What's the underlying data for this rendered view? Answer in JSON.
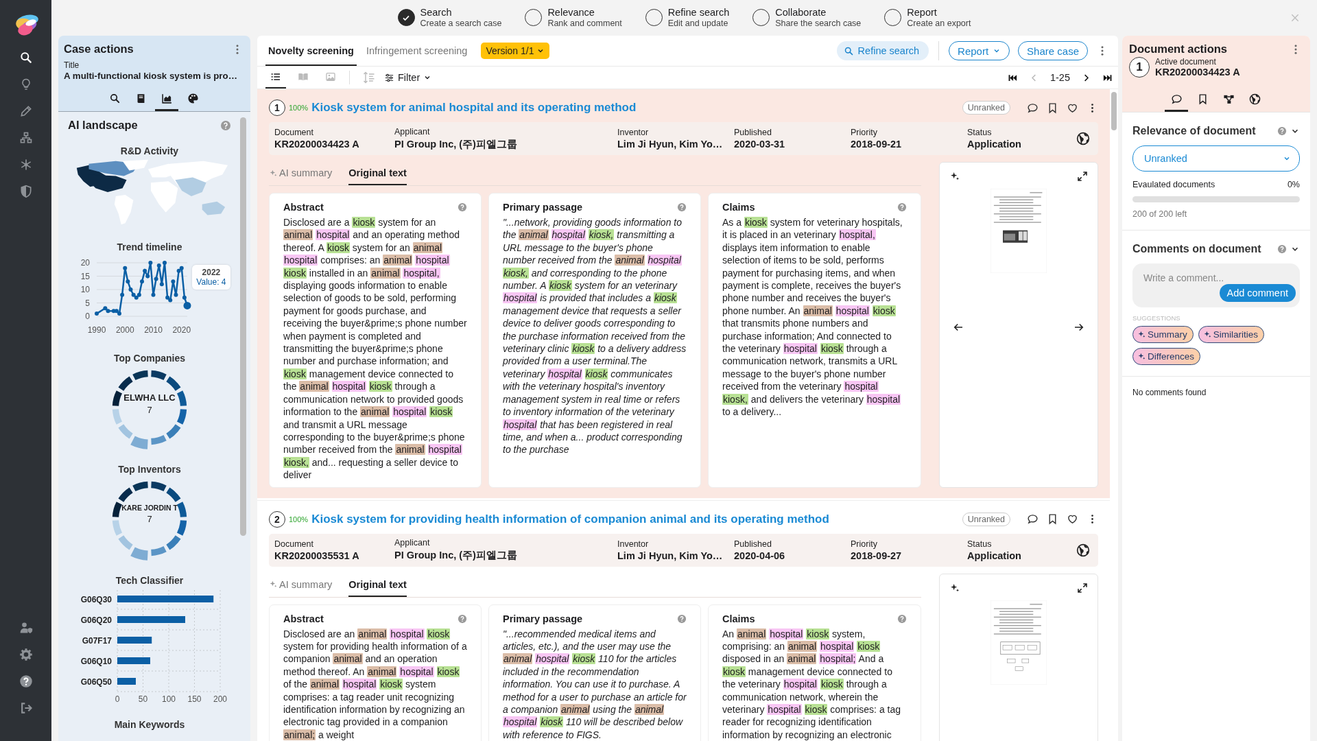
{
  "nav": {
    "items": [
      {
        "kind": "search",
        "selected": true
      },
      {
        "kind": "bulb",
        "selected": false
      },
      {
        "kind": "pencil",
        "selected": false
      },
      {
        "kind": "sitemap",
        "selected": false
      },
      {
        "kind": "hub",
        "selected": false
      },
      {
        "kind": "shield",
        "selected": false
      }
    ],
    "bottom_items": [
      {
        "kind": "user-shield",
        "selected": false
      },
      {
        "kind": "gear",
        "selected": false
      },
      {
        "kind": "help",
        "selected": false
      },
      {
        "kind": "logout",
        "selected": false
      }
    ]
  },
  "steps": [
    {
      "title": "Search",
      "subtitle": "Create a search case",
      "done": true
    },
    {
      "title": "Relevance",
      "subtitle": "Rank and comment",
      "done": false
    },
    {
      "title": "Refine search",
      "subtitle": "Edit and update",
      "done": false
    },
    {
      "title": "Collaborate",
      "subtitle": "Share the search case",
      "done": false
    },
    {
      "title": "Report",
      "subtitle": "Create an export",
      "done": false
    }
  ],
  "case_panel": {
    "heading": "Case actions",
    "title_label": "Title",
    "title": "A multi-functional kiosk system is pro…",
    "tabs": [
      {
        "kind": "search",
        "selected": false
      },
      {
        "kind": "book",
        "selected": false
      },
      {
        "kind": "chart",
        "selected": true
      },
      {
        "kind": "palette",
        "selected": false
      }
    ],
    "landscape": {
      "heading": "AI landscape",
      "map_title": "R&D Activity",
      "trend": {
        "chart_data": {
          "type": "line",
          "title": "Trend timeline",
          "x": [
            1990,
            1993,
            1994,
            1996,
            1997,
            1998,
            1999,
            2000,
            2001,
            2002,
            2003,
            2004,
            2005,
            2006,
            2007,
            2008,
            2009,
            2010,
            2011,
            2012,
            2013,
            2014,
            2015,
            2016,
            2017,
            2018,
            2019,
            2020,
            2021,
            2022
          ],
          "series": [
            {
              "color": "#0b5fa5",
              "values": [
                1,
                3,
                2,
                2,
                2,
                1,
                8,
                18,
                13,
                10,
                8,
                7,
                8,
                13,
                17,
                15,
                20,
                8,
                14,
                19,
                12,
                20,
                7,
                6,
                13,
                8,
                17,
                18,
                7,
                4
              ]
            }
          ],
          "xlim": [
            1990,
            2022
          ],
          "xticks": [
            1990,
            2000,
            2010,
            2020
          ],
          "yticks": [
            0,
            5,
            10,
            15,
            20
          ],
          "ylim": [
            0,
            20
          ],
          "grid": true,
          "marker": true
        },
        "tooltip": {
          "title": "2022",
          "value": "Value: 4"
        }
      },
      "companies": {
        "title": "Top Companies",
        "name": "ELWHA LLC",
        "count": "7"
      },
      "inventors": {
        "title": "Top Inventors",
        "name": "KARE JORDIN T",
        "count": "7"
      },
      "classifier": {
        "chart_data": {
          "type": "bar",
          "orientation": "horizontal",
          "title": "Tech Classifier",
          "categories": [
            "G06Q30",
            "G06Q20",
            "G07F17",
            "G06Q10",
            "G06Q50"
          ],
          "series": [
            {
              "color": "#0b5fa5",
              "values": [
                187,
                132,
                67,
                64,
                36
              ]
            }
          ],
          "xlim": [
            0,
            200
          ],
          "xticks": [
            0,
            50,
            100,
            150,
            200
          ],
          "grid": true
        }
      },
      "keywords_title": "Main Keywords"
    }
  },
  "results": {
    "tabs": [
      {
        "label": "Novelty screening",
        "selected": true
      },
      {
        "label": "Infringement screening",
        "selected": false
      }
    ],
    "version": "Version 1/1",
    "refine": "Refine search",
    "report": "Report",
    "share": "Share case",
    "views": [
      {
        "kind": "list",
        "selected": true
      },
      {
        "kind": "columns",
        "selected": false
      },
      {
        "kind": "image",
        "selected": false
      }
    ],
    "filter": "Filter",
    "range": "1-25",
    "docs": [
      {
        "number": "1",
        "score": "100%",
        "title": "Kiosk system for animal hospital and its operating method",
        "rank": "Unranked",
        "active": true,
        "image_nav": true,
        "thumbnail": {
          "kind": "photo"
        },
        "meta": [
          {
            "label": "Document",
            "value": "KR20200034423 A"
          },
          {
            "label": "Applicant",
            "value": "PI Group Inc, (주)피엘그룹"
          },
          {
            "label": "Inventor",
            "value": "Lim Ji Hyun, Kim Yo…"
          },
          {
            "label": "Published",
            "value": "2020-03-31"
          },
          {
            "label": "Priority",
            "value": "2018-09-21"
          },
          {
            "label": "Status",
            "value": "Application"
          }
        ],
        "subtabs": [
          {
            "label": "AI summary",
            "selected": false
          },
          {
            "label": "Original text",
            "selected": true
          }
        ],
        "sections": [
          {
            "kind": "abstract",
            "title": "Abstract",
            "parts": [
              "Disclosed are a ",
              {
                "t": "kiosk",
                "color": "#b8e194"
              },
              " system for an ",
              {
                "t": "animal ",
                "color": "#dbbda8"
              },
              {
                "t": "hospital",
                "color": "#f8c6f4"
              },
              " and an operating method thereof. A ",
              {
                "t": "kiosk",
                "color": "#b8e194"
              },
              " system for an ",
              {
                "t": "animal ",
                "color": "#dbbda8"
              },
              {
                "t": "hospital",
                "color": "#f8c6f4"
              },
              " comprises: an ",
              {
                "t": "animal ",
                "color": "#dbbda8"
              },
              {
                "t": "hospital ",
                "color": "#f8c6f4"
              },
              {
                "t": "kiosk",
                "color": "#b8e194"
              },
              " installed in an ",
              {
                "t": "animal ",
                "color": "#dbbda8"
              },
              {
                "t": "hospital,",
                "color": "#f8c6f4"
              },
              " displaying goods information to enable selection of goods to be sold, performing payment for goods purchase, and receiving the buyer&prime;s phone number when payment is completed and transmitting the buyer&prime;s phone number and purchase information; and ",
              {
                "t": "kiosk",
                "color": "#b8e194"
              },
              " management device connected to the ",
              {
                "t": "animal ",
                "color": "#dbbda8"
              },
              {
                "t": "hospital ",
                "color": "#f8c6f4"
              },
              {
                "t": "kiosk",
                "color": "#b8e194"
              },
              " through a communication network to provided goods information to the ",
              {
                "t": "animal ",
                "color": "#dbbda8"
              },
              {
                "t": "hospital ",
                "color": "#f8c6f4"
              },
              {
                "t": "kiosk",
                "color": "#b8e194"
              },
              " and transmit a URL message corresponding to the buyer&prime;s phone number received from the ",
              {
                "t": "animal ",
                "color": "#dbbda8"
              },
              {
                "t": "hospital ",
                "color": "#f8c6f4"
              },
              {
                "t": "kiosk,",
                "color": "#b8e194"
              },
              " and... requesting a seller device to deliver"
            ]
          },
          {
            "kind": "passage",
            "title": "Primary passage",
            "parts": [
              "\"...network, providing goods information to the ",
              {
                "t": "animal ",
                "color": "#dbbda8"
              },
              {
                "t": "hospital ",
                "color": "#f8c6f4"
              },
              {
                "t": "kiosk,",
                "color": "#b8e194"
              },
              " transmitting a URL message to the buyer's phone number received from the ",
              {
                "t": "animal ",
                "color": "#dbbda8"
              },
              {
                "t": "hospital ",
                "color": "#f8c6f4"
              },
              {
                "t": "kiosk,",
                "color": "#b8e194"
              },
              " and corresponding to the phone number. A ",
              {
                "t": "kiosk",
                "color": "#b8e194"
              },
              " system for an veterinary ",
              {
                "t": "hospital",
                "color": "#f8c6f4"
              },
              " is provided that includes a ",
              {
                "t": "kiosk",
                "color": "#b8e194"
              },
              " management device that requests a seller device to deliver goods corresponding to the purchase information received from the veterinary clinic ",
              {
                "t": "kiosk",
                "color": "#b8e194"
              },
              " to a delivery address provided from a user terminal.The veterinary ",
              {
                "t": "hospital ",
                "color": "#f8c6f4"
              },
              {
                "t": "kiosk",
                "color": "#b8e194"
              },
              " communicates with the veterinary hospital's inventory management system in real time or refers to inventory information of the veterinary ",
              {
                "t": "hospital",
                "color": "#f8c6f4"
              },
              " that has been registered in real time, and when a... product corresponding to the purchase"
            ]
          },
          {
            "kind": "claims",
            "title": "Claims",
            "parts": [
              "As a ",
              {
                "t": "kiosk",
                "color": "#b8e194"
              },
              " system for veterinary hospitals, it is placed in an veterinary ",
              {
                "t": "hospital,",
                "color": "#f8c6f4"
              },
              " displays item information to enable selection of items to be sold, performs payment for purchasing items, and when payment is complete, receives the buyer's phone number and receives the buyer's phone number. An ",
              {
                "t": "animal ",
                "color": "#dbbda8"
              },
              {
                "t": "hospital ",
                "color": "#f8c6f4"
              },
              {
                "t": "kiosk",
                "color": "#b8e194"
              },
              " that transmits phone numbers and purchase information; And connected to the veterinary ",
              {
                "t": "hospital ",
                "color": "#f8c6f4"
              },
              {
                "t": "kiosk",
                "color": "#b8e194"
              },
              " through a communication network, transmits a URL message to the buyer's phone number received from the veterinary ",
              {
                "t": "hospital ",
                "color": "#f8c6f4"
              },
              {
                "t": "kiosk,",
                "color": "#b8e194"
              },
              " and delivers the veterinary ",
              {
                "t": "hospital",
                "color": "#f8c6f4"
              },
              " to a delivery..."
            ]
          }
        ]
      },
      {
        "number": "2",
        "score": "100%",
        "title": "Kiosk system for providing health information of companion animal and its operating method",
        "rank": "Unranked",
        "active": false,
        "image_nav": false,
        "thumbnail": {
          "kind": "diagram"
        },
        "meta": [
          {
            "label": "Document",
            "value": "KR20200035531 A"
          },
          {
            "label": "Applicant",
            "value": "PI Group Inc, (주)피엘그룹"
          },
          {
            "label": "Inventor",
            "value": "Lim Ji Hyun, Kim Yo…"
          },
          {
            "label": "Published",
            "value": "2020-04-06"
          },
          {
            "label": "Priority",
            "value": "2018-09-27"
          },
          {
            "label": "Status",
            "value": "Application"
          }
        ],
        "subtabs": [
          {
            "label": "AI summary",
            "selected": false
          },
          {
            "label": "Original text",
            "selected": true
          }
        ],
        "sections": [
          {
            "kind": "abstract",
            "title": "Abstract",
            "parts": [
              "Disclosed are an ",
              {
                "t": "animal ",
                "color": "#dbbda8"
              },
              {
                "t": "hospital ",
                "color": "#f8c6f4"
              },
              {
                "t": "kiosk",
                "color": "#b8e194"
              },
              " system for providing health information of a companion ",
              {
                "t": "animal",
                "color": "#dbbda8"
              },
              " and an operation method thereof. An ",
              {
                "t": "animal ",
                "color": "#dbbda8"
              },
              {
                "t": "hospital ",
                "color": "#f8c6f4"
              },
              {
                "t": "kiosk",
                "color": "#b8e194"
              },
              " of the ",
              {
                "t": "animal ",
                "color": "#dbbda8"
              },
              {
                "t": "hospital ",
                "color": "#f8c6f4"
              },
              {
                "t": "kiosk",
                "color": "#b8e194"
              },
              " system comprises: a tag reader unit recognizing identification information by recognizing an electronic tag provided in a companion ",
              {
                "t": "animal;",
                "color": "#dbbda8"
              },
              " a weight"
            ]
          },
          {
            "kind": "passage",
            "title": "Primary passage",
            "parts": [
              "\"...recommended medical items and articles, etc.), and the user may use the ",
              {
                "t": "animal ",
                "color": "#dbbda8"
              },
              {
                "t": "hospital ",
                "color": "#f8c6f4"
              },
              {
                "t": "kiosk",
                "color": "#b8e194"
              },
              " 110 for the articles included in the recommendation information. You can use it to purchase. A method for a user to purchase an article for a companion ",
              {
                "t": "animal",
                "color": "#dbbda8"
              },
              " using the ",
              {
                "t": "animal ",
                "color": "#dbbda8"
              },
              {
                "t": "hospital ",
                "color": "#f8c6f4"
              },
              {
                "t": "kiosk",
                "color": "#b8e194"
              },
              " 110 will be described below with reference to FIGS."
            ]
          },
          {
            "kind": "claims",
            "title": "Claims",
            "parts": [
              "An ",
              {
                "t": "animal ",
                "color": "#dbbda8"
              },
              {
                "t": "hospital ",
                "color": "#f8c6f4"
              },
              {
                "t": "kiosk",
                "color": "#b8e194"
              },
              " system, comprising: an ",
              {
                "t": "animal ",
                "color": "#dbbda8"
              },
              {
                "t": "hospital ",
                "color": "#f8c6f4"
              },
              {
                "t": "kiosk",
                "color": "#b8e194"
              },
              " disposed in an ",
              {
                "t": "animal ",
                "color": "#dbbda8"
              },
              {
                "t": "hospital;",
                "color": "#f8c6f4"
              },
              " And a ",
              {
                "t": "kiosk",
                "color": "#b8e194"
              },
              " management device connected to the veterinary ",
              {
                "t": "hospital ",
                "color": "#f8c6f4"
              },
              {
                "t": "kiosk",
                "color": "#b8e194"
              },
              " through a communication network, wherein the veterinary ",
              {
                "t": "hospital ",
                "color": "#f8c6f4"
              },
              {
                "t": "kiosk",
                "color": "#b8e194"
              },
              " comprises: a tag reader for recognizing identification information by recognizing an electronic"
            ]
          }
        ]
      }
    ]
  },
  "doc_panel": {
    "heading": "Document actions",
    "number": "1",
    "active_label": "Active document",
    "active_doc": "KR20200034423 A",
    "tabs": [
      {
        "kind": "comment",
        "selected": true
      },
      {
        "kind": "bookmark",
        "selected": false
      },
      {
        "kind": "nodes",
        "selected": false
      },
      {
        "kind": "globe",
        "selected": false
      }
    ],
    "relevance": {
      "title": "Relevance of document",
      "value": "Unranked",
      "progress_label": "Evaulated documents",
      "percent": "0%",
      "level": 0,
      "left": "200 of 200 left"
    },
    "comments": {
      "title": "Comments on document",
      "placeholder": "Write a comment...",
      "add": "Add comment",
      "suggestions_label": "SUGGESTIONS",
      "suggestions": [
        "Summary",
        "Similarities",
        "Differences"
      ],
      "empty": "No comments found"
    }
  }
}
